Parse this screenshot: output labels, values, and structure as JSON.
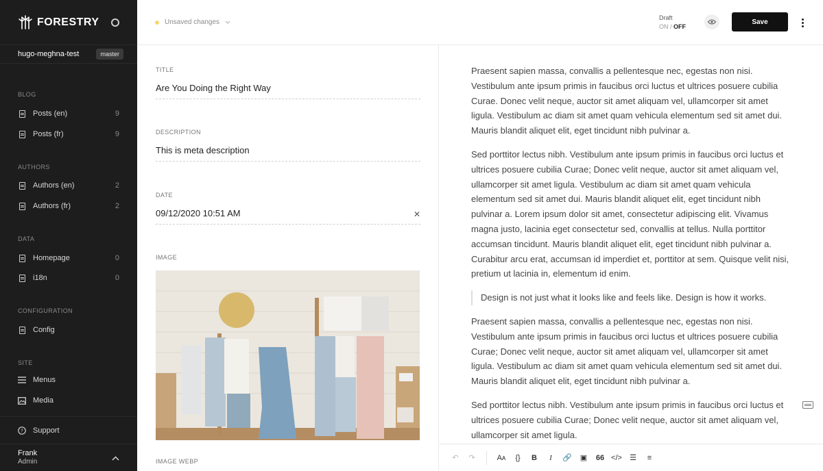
{
  "sidebar": {
    "brand": "FORESTRY",
    "site_name": "hugo-meghna-test",
    "branch": "master",
    "sections": [
      {
        "title": "BLOG",
        "items": [
          {
            "label": "Posts (en)",
            "count": "9"
          },
          {
            "label": "Posts (fr)",
            "count": "9"
          }
        ]
      },
      {
        "title": "AUTHORS",
        "items": [
          {
            "label": "Authors (en)",
            "count": "2"
          },
          {
            "label": "Authors (fr)",
            "count": "2"
          }
        ]
      },
      {
        "title": "DATA",
        "items": [
          {
            "label": "Homepage",
            "count": "0"
          },
          {
            "label": "i18n",
            "count": "0"
          }
        ]
      },
      {
        "title": "CONFIGURATION",
        "items": [
          {
            "label": "Config",
            "count": ""
          }
        ]
      },
      {
        "title": "SITE",
        "items": [
          {
            "label": "Menus",
            "count": ""
          },
          {
            "label": "Media",
            "count": ""
          }
        ]
      }
    ],
    "support": "Support",
    "user": {
      "name": "Frank",
      "role": "Admin"
    }
  },
  "topbar": {
    "status": "Unsaved changes",
    "status_color": "#f7d774",
    "draft_label": "Draft",
    "draft_on": "ON",
    "draft_sep": "/",
    "draft_off": "OFF",
    "save_label": "Save"
  },
  "form": {
    "title_label": "TITLE",
    "title_value": "Are You Doing the Right Way",
    "description_label": "DESCRIPTION",
    "description_value": "This is meta description",
    "date_label": "DATE",
    "date_value": "09/12/2020 10:51 AM",
    "image_label": "IMAGE",
    "image_webp_label": "IMAGE WEBP"
  },
  "content": {
    "paragraphs": [
      "Praesent sapien massa, convallis a pellentesque nec, egestas non nisi. Vestibulum ante ipsum primis in faucibus orci luctus et ultrices posuere cubilia Curae. Donec velit neque, auctor sit amet aliquam vel, ullamcorper sit amet ligula. Vestibulum ac diam sit amet quam vehicula elementum sed sit amet dui. Mauris blandit aliquet elit, eget tincidunt nibh pulvinar a.",
      "Sed porttitor lectus nibh. Vestibulum ante ipsum primis in faucibus orci luctus et ultrices posuere cubilia Curae; Donec velit neque, auctor sit amet aliquam vel, ullamcorper sit amet ligula. Vestibulum ac diam sit amet quam vehicula elementum sed sit amet dui. Mauris blandit aliquet elit, eget tincidunt nibh pulvinar a. Lorem ipsum dolor sit amet, consectetur adipiscing elit. Vivamus magna justo, lacinia eget consectetur sed, convallis at tellus. Nulla porttitor accumsan tincidunt. Mauris blandit aliquet elit, eget tincidunt nibh pulvinar a. Curabitur arcu erat, accumsan id imperdiet et, porttitor at sem. Quisque velit nisi, pretium ut lacinia in, elementum id enim.",
      "Praesent sapien massa, convallis a pellentesque nec, egestas non nisi. Vestibulum ante ipsum primis in faucibus orci luctus et ultrices posuere cubilia Curae; Donec velit neque, auctor sit amet aliquam vel, ullamcorper sit amet ligula. Vestibulum ac diam sit amet quam vehicula elementum sed sit amet dui. Mauris blandit aliquet elit, eget tincidunt nibh pulvinar a.",
      "Sed porttitor lectus nibh. Vestibulum ante ipsum primis in faucibus orci luctus et ultrices posuere cubilia Curae; Donec velit neque, auctor sit amet aliquam vel, ullamcorper sit amet ligula."
    ],
    "quote": "Design is not just what it looks like and feels like. Design is how it works."
  },
  "toolbar": {
    "undo": "↶",
    "redo": "↷",
    "text_size": "Aᴀ",
    "code_block": "{}",
    "bold": "B",
    "italic": "I",
    "link": "🔗",
    "image": "▣",
    "quote": "66",
    "code": "</>",
    "bullet_list": "☰",
    "numbered_list": "≡"
  }
}
